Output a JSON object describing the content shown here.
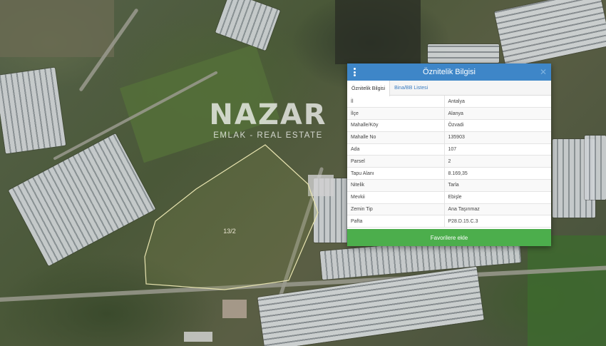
{
  "watermark": {
    "brand": "NAZAR",
    "tagline": "EMLAK - REAL ESTATE"
  },
  "map": {
    "parcel_label": "13/2"
  },
  "dialog": {
    "title": "Öznitelik Bilgisi",
    "close_symbol": "✕",
    "tabs": [
      {
        "label": "Öznitelik Bilgisi",
        "active": true
      },
      {
        "label": "Bina/BB Listesi",
        "active": false
      }
    ],
    "rows": [
      {
        "key": "İl",
        "value": "Antalya"
      },
      {
        "key": "İlçe",
        "value": "Alanya"
      },
      {
        "key": "Mahalle/Köy",
        "value": "Özvadi"
      },
      {
        "key": "Mahalle No",
        "value": "135903"
      },
      {
        "key": "Ada",
        "value": "107"
      },
      {
        "key": "Parsel",
        "value": "2"
      },
      {
        "key": "Tapu Alanı",
        "value": "8.169,35"
      },
      {
        "key": "Nitelik",
        "value": "Tarla"
      },
      {
        "key": "Mevkii",
        "value": "Ebişle"
      },
      {
        "key": "Zemin Tip",
        "value": "Ana Taşınmaz"
      },
      {
        "key": "Pafta",
        "value": "P28.D.15.C.3"
      }
    ],
    "favorite_button": "Favorilere ekle"
  },
  "colors": {
    "header_blue": "#3e86c8",
    "button_green": "#4cae4c",
    "parcel_outline": "#e8e4b0"
  }
}
